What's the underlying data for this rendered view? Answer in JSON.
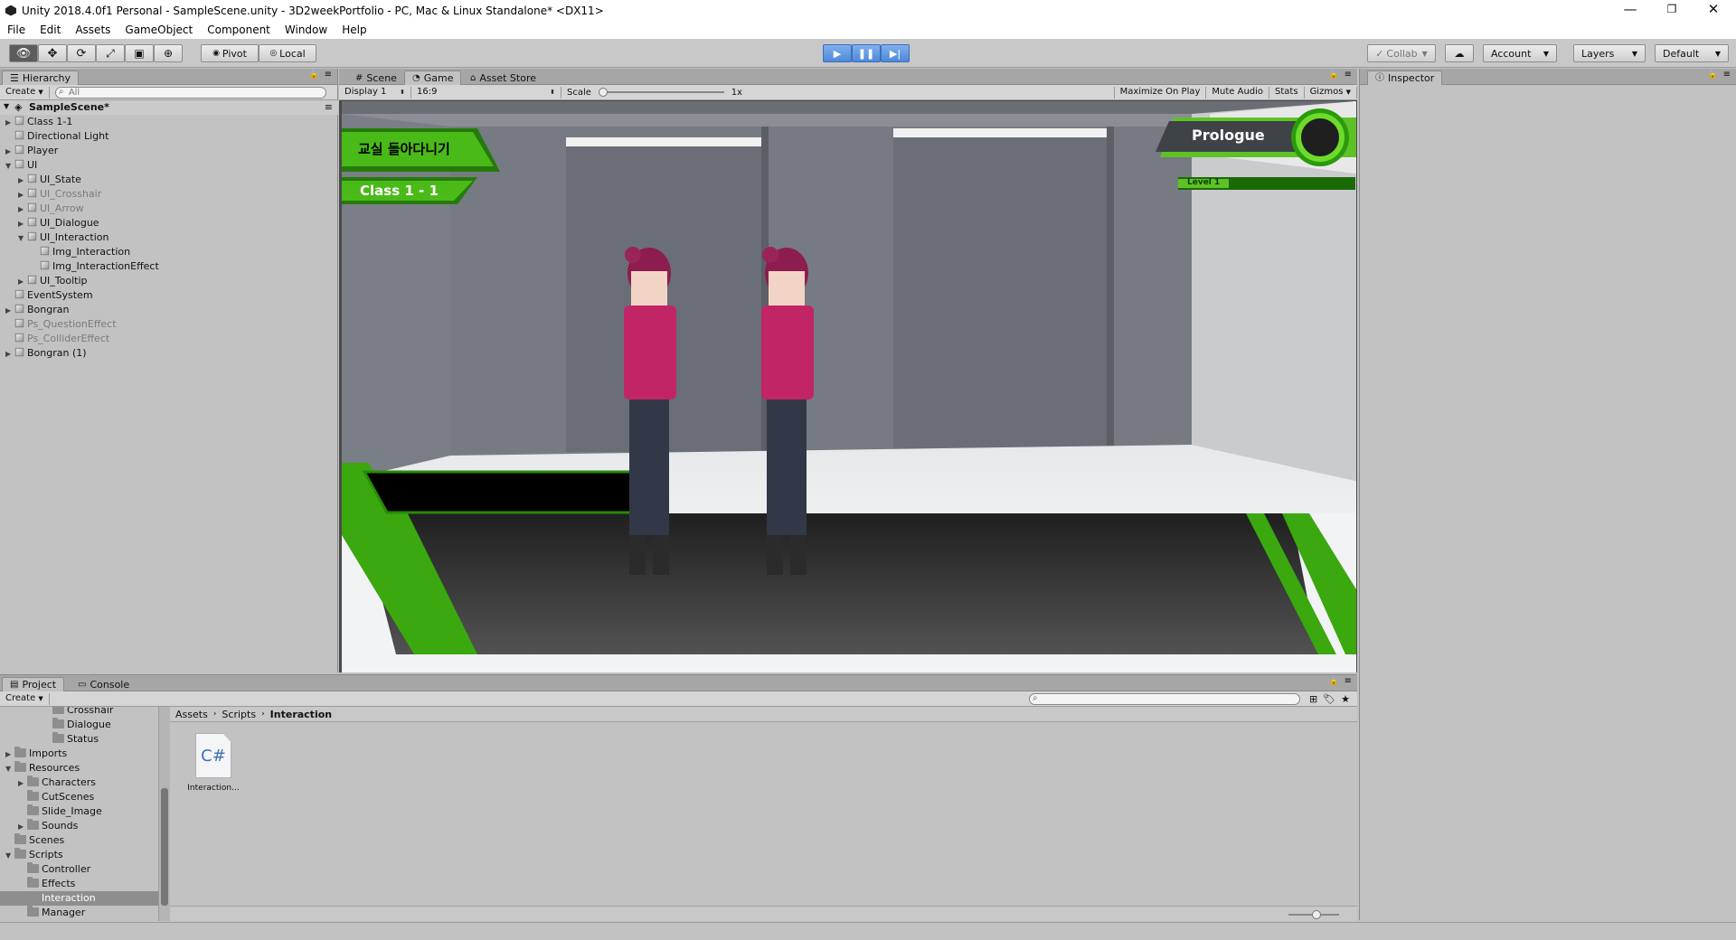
{
  "window": {
    "title": "Unity 2018.4.0f1 Personal - SampleScene.unity - 3D2weekPortfolio - PC, Mac & Linux Standalone* <DX11>",
    "controls": {
      "minimize": "—",
      "restore": "❐",
      "close": "✕"
    }
  },
  "menu": [
    "File",
    "Edit",
    "Assets",
    "GameObject",
    "Component",
    "Window",
    "Help"
  ],
  "toolbar": {
    "pivot": "Pivot",
    "local": "Local",
    "collab": "Collab",
    "account": "Account",
    "layers": "Layers",
    "layout": "Default"
  },
  "hierarchy": {
    "tab": "Hierarchy",
    "create": "Create",
    "search_placeholder": "All",
    "scene": "SampleScene*",
    "items": [
      {
        "label": "Class 1-1",
        "depth": 1,
        "arrow": "right",
        "dim": false
      },
      {
        "label": "Directional Light",
        "depth": 1,
        "arrow": "",
        "dim": false
      },
      {
        "label": "Player",
        "depth": 1,
        "arrow": "right",
        "dim": false
      },
      {
        "label": "UI",
        "depth": 1,
        "arrow": "down",
        "dim": false
      },
      {
        "label": "UI_State",
        "depth": 2,
        "arrow": "right",
        "dim": false
      },
      {
        "label": "UI_Crosshair",
        "depth": 2,
        "arrow": "right",
        "dim": true
      },
      {
        "label": "UI_Arrow",
        "depth": 2,
        "arrow": "right",
        "dim": true
      },
      {
        "label": "UI_Dialogue",
        "depth": 2,
        "arrow": "right",
        "dim": false
      },
      {
        "label": "UI_Interaction",
        "depth": 2,
        "arrow": "down",
        "dim": false
      },
      {
        "label": "Img_Interaction",
        "depth": 3,
        "arrow": "",
        "dim": false
      },
      {
        "label": "Img_InteractionEffect",
        "depth": 3,
        "arrow": "",
        "dim": false
      },
      {
        "label": "UI_Tooltip",
        "depth": 2,
        "arrow": "right",
        "dim": false
      },
      {
        "label": "EventSystem",
        "depth": 1,
        "arrow": "",
        "dim": false
      },
      {
        "label": "Bongran",
        "depth": 1,
        "arrow": "right",
        "dim": false
      },
      {
        "label": "Ps_QuestionEffect",
        "depth": 1,
        "arrow": "",
        "dim": true
      },
      {
        "label": "Ps_ColliderEffect",
        "depth": 1,
        "arrow": "",
        "dim": true
      },
      {
        "label": "Bongran (1)",
        "depth": 1,
        "arrow": "right",
        "dim": false
      }
    ]
  },
  "center": {
    "tabs": [
      "Scene",
      "Game",
      "Asset Store"
    ],
    "display": "Display 1",
    "aspect": "16:9",
    "scale_label": "Scale",
    "scale_value": "1x",
    "options": [
      "Maximize On Play",
      "Mute Audio",
      "Stats",
      "Gizmos"
    ]
  },
  "game": {
    "quest_title": "교실 돌아다니기",
    "location": "Class 1 - 1",
    "chapter": "Prologue",
    "level": "Level 1"
  },
  "inspector": {
    "tab": "Inspector"
  },
  "project": {
    "tabs": [
      "Project",
      "Console"
    ],
    "create": "Create",
    "breadcrumb": [
      "Assets",
      "Scripts",
      "Interaction"
    ],
    "tree": [
      {
        "label": "Crosshair",
        "depth": 4,
        "arrow": ""
      },
      {
        "label": "Dialogue",
        "depth": 4,
        "arrow": ""
      },
      {
        "label": "Status",
        "depth": 4,
        "arrow": ""
      },
      {
        "label": "Imports",
        "depth": 1,
        "arrow": "right"
      },
      {
        "label": "Resources",
        "depth": 1,
        "arrow": "down"
      },
      {
        "label": "Characters",
        "depth": 2,
        "arrow": "right"
      },
      {
        "label": "CutScenes",
        "depth": 2,
        "arrow": ""
      },
      {
        "label": "Slide_Image",
        "depth": 2,
        "arrow": ""
      },
      {
        "label": "Sounds",
        "depth": 2,
        "arrow": "right"
      },
      {
        "label": "Scenes",
        "depth": 1,
        "arrow": ""
      },
      {
        "label": "Scripts",
        "depth": 1,
        "arrow": "down"
      },
      {
        "label": "Controller",
        "depth": 2,
        "arrow": ""
      },
      {
        "label": "Effects",
        "depth": 2,
        "arrow": ""
      },
      {
        "label": "Interaction",
        "depth": 2,
        "arrow": "",
        "selected": true
      },
      {
        "label": "Manager",
        "depth": 2,
        "arrow": ""
      }
    ],
    "files": [
      {
        "name": "Interaction...",
        "icon_text": "C#"
      }
    ]
  }
}
